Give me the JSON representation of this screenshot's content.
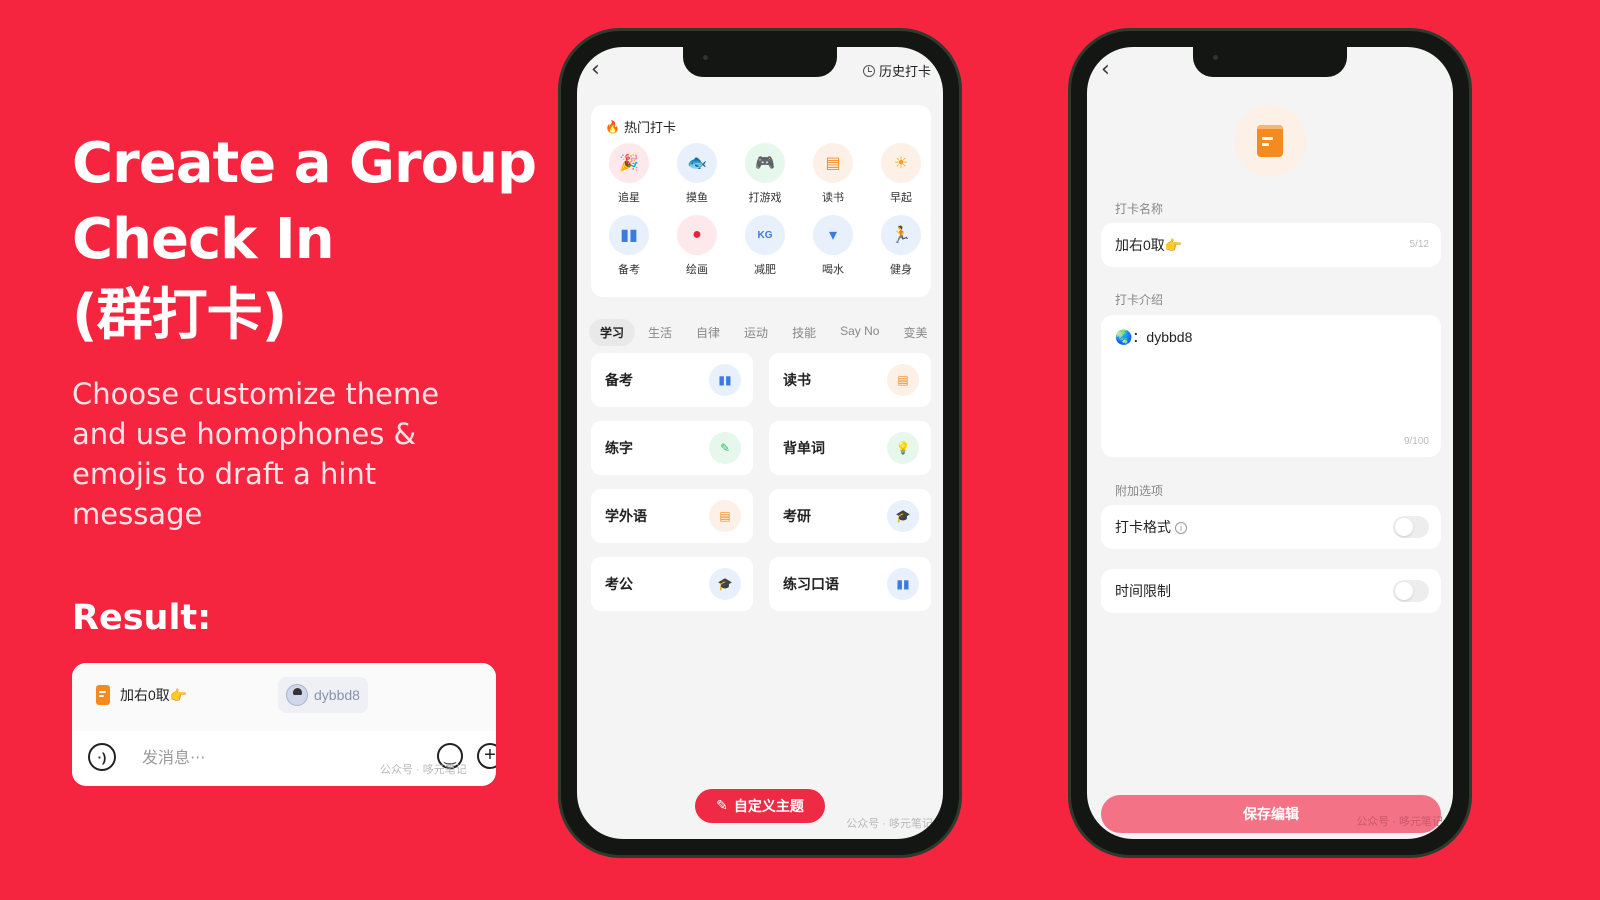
{
  "left_panel": {
    "headline": [
      "Create a Group",
      "Check In",
      "(群打卡)"
    ],
    "subtext": "Choose customize theme and use homophones & emojis to draft a hint message",
    "result_label": "Result:",
    "result_card": {
      "title_chip": "加右0取👉",
      "user_chip": "dybbd8",
      "message_placeholder": "发消息···",
      "watermark": "公众号 · 哆元笔记"
    }
  },
  "phone1": {
    "back_icon": "chevron-left-icon",
    "history_label": "历史打卡",
    "hot_section": {
      "title": "热门打卡",
      "items": [
        {
          "label": "追星",
          "icon": "party-popper-icon",
          "glyph": "🎉",
          "color": "#e8233a",
          "bg": "#fde8eb"
        },
        {
          "label": "摸鱼",
          "icon": "fish-icon",
          "glyph": "🐟",
          "color": "#3b7be0",
          "bg": "#e8f0fc"
        },
        {
          "label": "打游戏",
          "icon": "gamepad-icon",
          "glyph": "🎮",
          "color": "#2fbf63",
          "bg": "#e6f7ec"
        },
        {
          "label": "读书",
          "icon": "book-icon",
          "glyph": "▤",
          "color": "#f58b1f",
          "bg": "#fdf0e6"
        },
        {
          "label": "早起",
          "icon": "sun-icon",
          "glyph": "☀",
          "color": "#f5a11f",
          "bg": "#fdf0e6"
        },
        {
          "label": "备考",
          "icon": "open-book-icon",
          "glyph": "▮▮",
          "color": "#3b7be0",
          "bg": "#e8f0fc"
        },
        {
          "label": "绘画",
          "icon": "palette-icon",
          "glyph": "●",
          "color": "#e8233a",
          "bg": "#fde8eb"
        },
        {
          "label": "减肥",
          "icon": "scale-kg-icon",
          "glyph": "KG",
          "color": "#3b7be0",
          "bg": "#e8f0fc"
        },
        {
          "label": "喝水",
          "icon": "water-glass-icon",
          "glyph": "▾",
          "color": "#3b7be0",
          "bg": "#e8f0fc"
        },
        {
          "label": "健身",
          "icon": "running-icon",
          "glyph": "🏃",
          "color": "#3b7be0",
          "bg": "#e8f0fc"
        }
      ]
    },
    "tabs": [
      {
        "label": "学习",
        "active": true
      },
      {
        "label": "生活",
        "active": false
      },
      {
        "label": "自律",
        "active": false
      },
      {
        "label": "运动",
        "active": false
      },
      {
        "label": "技能",
        "active": false
      },
      {
        "label": "Say No",
        "active": false
      },
      {
        "label": "变美",
        "active": false
      }
    ],
    "topics": [
      {
        "label": "备考",
        "icon": "open-book-icon",
        "glyph": "▮▮",
        "color": "#3b7be0",
        "bg": "#e8f0fc"
      },
      {
        "label": "读书",
        "icon": "book-icon",
        "glyph": "▤",
        "color": "#f58b1f",
        "bg": "#fdf0e6"
      },
      {
        "label": "练字",
        "icon": "pen-writing-icon",
        "glyph": "✎",
        "color": "#2fbf63",
        "bg": "#e6f7ec"
      },
      {
        "label": "背单词",
        "icon": "lightbulb-icon",
        "glyph": "💡",
        "color": "#2fbf63",
        "bg": "#e6f7ec"
      },
      {
        "label": "学外语",
        "icon": "book-icon",
        "glyph": "▤",
        "color": "#f58b1f",
        "bg": "#fdf0e6"
      },
      {
        "label": "考研",
        "icon": "graduation-cap-icon",
        "glyph": "🎓",
        "color": "#3b7be0",
        "bg": "#e8f0fc"
      },
      {
        "label": "考公",
        "icon": "graduation-cap-icon",
        "glyph": "🎓",
        "color": "#3b7be0",
        "bg": "#e8f0fc"
      },
      {
        "label": "练习口语",
        "icon": "open-book-icon",
        "glyph": "▮▮",
        "color": "#3b7be0",
        "bg": "#e8f0fc"
      }
    ],
    "custom_button": "自定义主题",
    "watermark": "公众号 · 哆元笔记"
  },
  "phone2": {
    "back_icon": "chevron-left-icon",
    "theme_icon": "book-icon",
    "name_section_label": "打卡名称",
    "name_value": "加右0取👉",
    "name_counter": "5/12",
    "intro_section_label": "打卡介绍",
    "intro_value": "🌏：dybbd8",
    "intro_counter": "9/100",
    "options_section_label": "附加选项",
    "options": [
      {
        "label": "打卡格式",
        "has_info": true,
        "enabled": false
      },
      {
        "label": "时间限制",
        "has_info": false,
        "enabled": false
      }
    ],
    "save_button": "保存编辑",
    "watermark": "公众号 · 哆元笔记"
  },
  "colors": {
    "background": "#f5253f",
    "accent": "#ee2a44",
    "save_button": "#f47285"
  }
}
